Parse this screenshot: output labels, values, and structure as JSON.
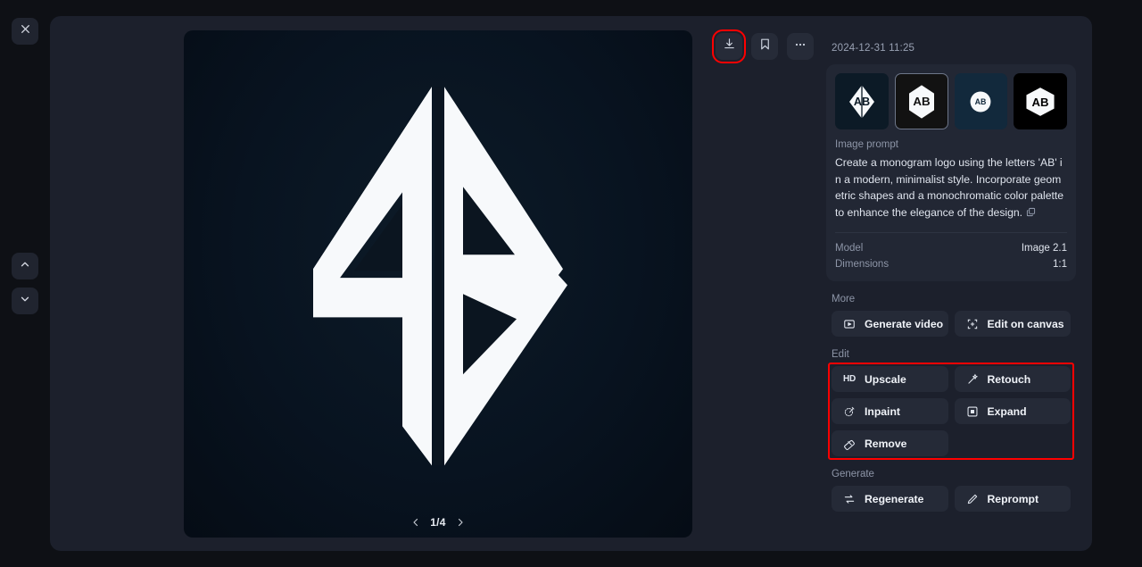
{
  "rail": {
    "close_icon": "close-icon",
    "prev_icon": "chevron-up-icon",
    "next_icon": "chevron-down-icon"
  },
  "toolbar": {
    "download_label": "Download",
    "bookmark_label": "Bookmark",
    "more_label": "More options",
    "highlight_color": "#ff0000"
  },
  "viewer": {
    "pager_text": "1/4",
    "prev_label": "Previous image",
    "next_label": "Next image",
    "alt": "AB monogram logo, diamond geometric style, white on dark navy"
  },
  "sidebar": {
    "timestamp": "2024-12-31 11:25",
    "thumbnails": [
      {
        "name": "variation-1",
        "selected": false,
        "bg": "#0c1a26"
      },
      {
        "name": "variation-2",
        "selected": true,
        "bg": "#121212"
      },
      {
        "name": "variation-3",
        "selected": false,
        "bg": "#12293c"
      },
      {
        "name": "variation-4",
        "selected": false,
        "bg": "#000000"
      }
    ],
    "prompt_label": "Image prompt",
    "prompt_text": "Create a monogram logo using the letters 'AB' in a modern, minimalist style. Incorporate geometric shapes and a monochromatic color palette to enhance the elegance of the design.",
    "copy_icon": "copy-icon",
    "meta": [
      {
        "key": "Model",
        "value": "Image 2.1"
      },
      {
        "key": "Dimensions",
        "value": "1:1"
      }
    ],
    "sections": [
      {
        "name": "more",
        "title": "More",
        "highlighted": false,
        "actions": [
          {
            "name": "generate-video",
            "label": "Generate video",
            "icon": "video-frame-icon"
          },
          {
            "name": "edit-on-canvas",
            "label": "Edit on canvas",
            "icon": "crop-frame-icon"
          }
        ]
      },
      {
        "name": "edit",
        "title": "Edit",
        "highlighted": true,
        "actions": [
          {
            "name": "upscale",
            "label": "Upscale",
            "icon": "hd-icon"
          },
          {
            "name": "retouch",
            "label": "Retouch",
            "icon": "magic-wand-icon"
          },
          {
            "name": "inpaint",
            "label": "Inpaint",
            "icon": "brush-circle-icon"
          },
          {
            "name": "expand",
            "label": "Expand",
            "icon": "expand-frame-icon"
          },
          {
            "name": "remove",
            "label": "Remove",
            "icon": "eraser-icon"
          }
        ]
      },
      {
        "name": "generate",
        "title": "Generate",
        "highlighted": false,
        "actions": [
          {
            "name": "regenerate",
            "label": "Regenerate",
            "icon": "refresh-icon"
          },
          {
            "name": "reprompt",
            "label": "Reprompt",
            "icon": "pencil-icon"
          }
        ]
      }
    ]
  }
}
